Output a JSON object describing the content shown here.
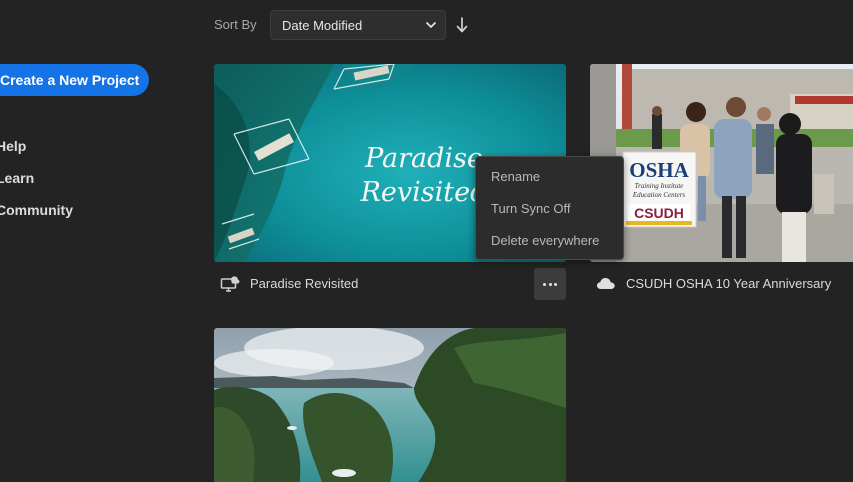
{
  "sidebar": {
    "create_button": "Create a New Project",
    "links": [
      "Help",
      "Learn",
      "Community"
    ]
  },
  "sort": {
    "label": "Sort By",
    "selected": "Date Modified",
    "direction": "descending"
  },
  "projects": [
    {
      "title": "Paradise Revisited",
      "thumbnail_text": [
        "Paradise",
        "Revisited"
      ],
      "status_icon": "local-computer-sync-icon"
    },
    {
      "title": "CSUDH OSHA 10 Year Anniversary",
      "thumbnail_text": [
        "OSHA",
        "Training Institute",
        "Education Centers",
        "CSUDH"
      ],
      "status_icon": "cloud-icon"
    },
    {
      "title": "",
      "thumbnail_text": [],
      "status_icon": ""
    }
  ],
  "context_menu": {
    "items": [
      "Rename",
      "Turn Sync Off",
      "Delete everywhere"
    ]
  },
  "colors": {
    "background": "#232323",
    "accent": "#1473e6",
    "menu_background": "#2c2c2c",
    "more_button": "#3c3c3c"
  }
}
